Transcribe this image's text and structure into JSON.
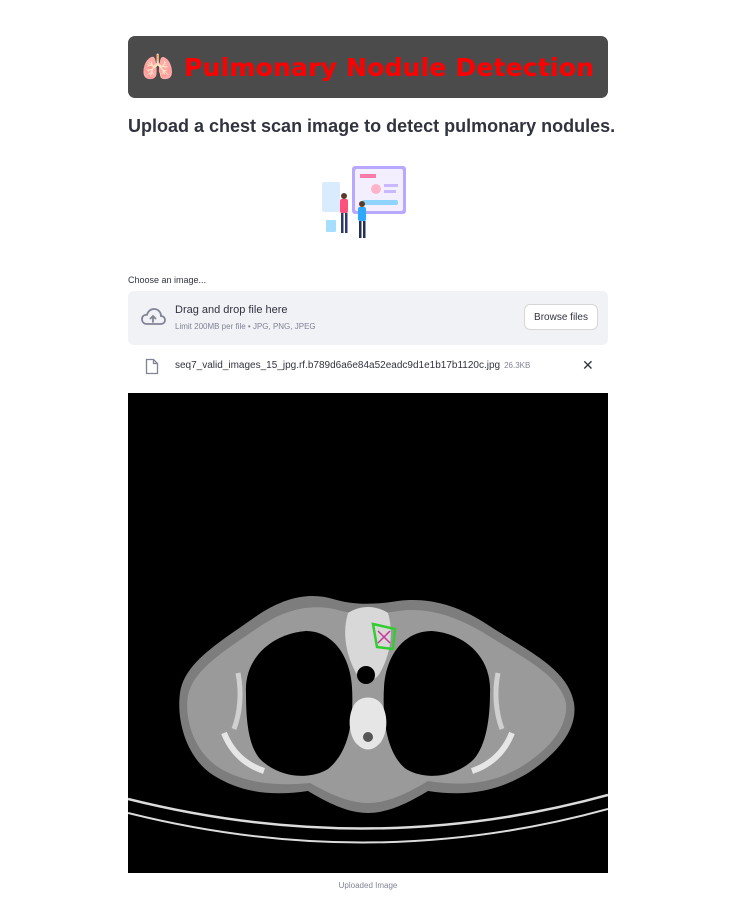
{
  "header": {
    "icon": "lungs-icon",
    "title": "Pulmonary Nodule Detection",
    "title_color": "#ff0000",
    "bar_color": "#4b4b4b"
  },
  "subtitle": "Upload a chest scan image to detect pulmonary nodules.",
  "illustration": {
    "icon": "doctors-with-screen-illustration"
  },
  "uploader": {
    "label": "Choose an image...",
    "drop_title": "Drag and drop file here",
    "limit_text": "Limit 200MB per file • JPG, PNG, JPEG",
    "browse_label": "Browse files",
    "cloud_icon": "cloud-upload-icon"
  },
  "uploaded_file": {
    "name": "seq7_valid_images_15_jpg.rf.b789d6a6e84a52eadc9d1e1b17b1120c.jpg",
    "size": "26.3KB",
    "file_icon": "file-icon",
    "close_icon": "close-icon"
  },
  "image": {
    "alt": "chest CT scan with detected nodule",
    "caption": "Uploaded Image",
    "detection_box_color": "#33cc33",
    "detection_mark_color": "#cc3399"
  }
}
